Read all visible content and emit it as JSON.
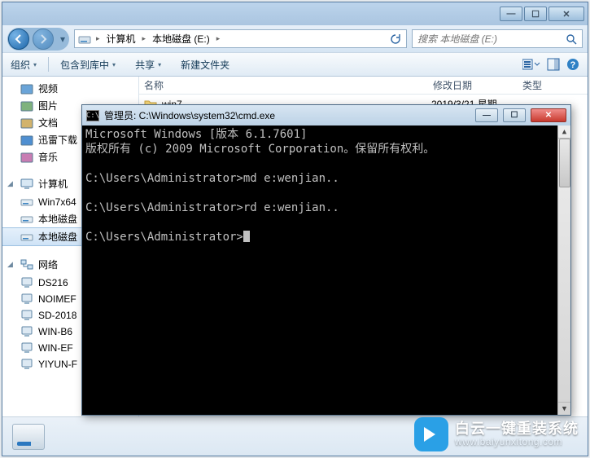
{
  "explorer": {
    "caption_min": "—",
    "caption_max": "☐",
    "caption_close": "✕",
    "breadcrumb": {
      "parts": [
        "计算机",
        "本地磁盘 (E:)"
      ]
    },
    "search_placeholder": "搜索 本地磁盘 (E:)",
    "toolbar": {
      "organize": "组织",
      "include": "包含到库中",
      "share": "共享",
      "newfolder": "新建文件夹"
    },
    "columns": {
      "name": "名称",
      "date": "修改日期",
      "type": "类型"
    },
    "rows": [
      {
        "name": "win7",
        "date": "2019/3/21 星期…"
      }
    ],
    "sidebar": {
      "libs": [
        {
          "label": "视频",
          "hex": "#6aa4d8"
        },
        {
          "label": "图片",
          "hex": "#7fb27d"
        },
        {
          "label": "文档",
          "hex": "#d2b36c"
        },
        {
          "label": "迅雷下载",
          "hex": "#4f8fd1"
        },
        {
          "label": "音乐",
          "hex": "#c87db3"
        }
      ],
      "computer": "计算机",
      "drives": [
        {
          "label": "Win7x64"
        },
        {
          "label": "本地磁盘"
        },
        {
          "label": "本地磁盘",
          "selected": true
        }
      ],
      "network": "网络",
      "hosts": [
        "DS216",
        "NOIMEF",
        "SD-2018",
        "WIN-B6",
        "WIN-EF",
        "YIYUN-F"
      ]
    }
  },
  "cmd": {
    "title": "管理员: C:\\Windows\\system32\\cmd.exe",
    "lines": [
      "Microsoft Windows [版本 6.1.7601]",
      "版权所有 (c) 2009 Microsoft Corporation。保留所有权利。",
      "",
      "C:\\Users\\Administrator>md e:wenjian..",
      "",
      "C:\\Users\\Administrator>rd e:wenjian..",
      "",
      "C:\\Users\\Administrator>"
    ]
  },
  "watermark": {
    "big": "白云一键重装系统",
    "url": "www.baiyunxitong.com",
    "accent": "#2aa0e6"
  }
}
